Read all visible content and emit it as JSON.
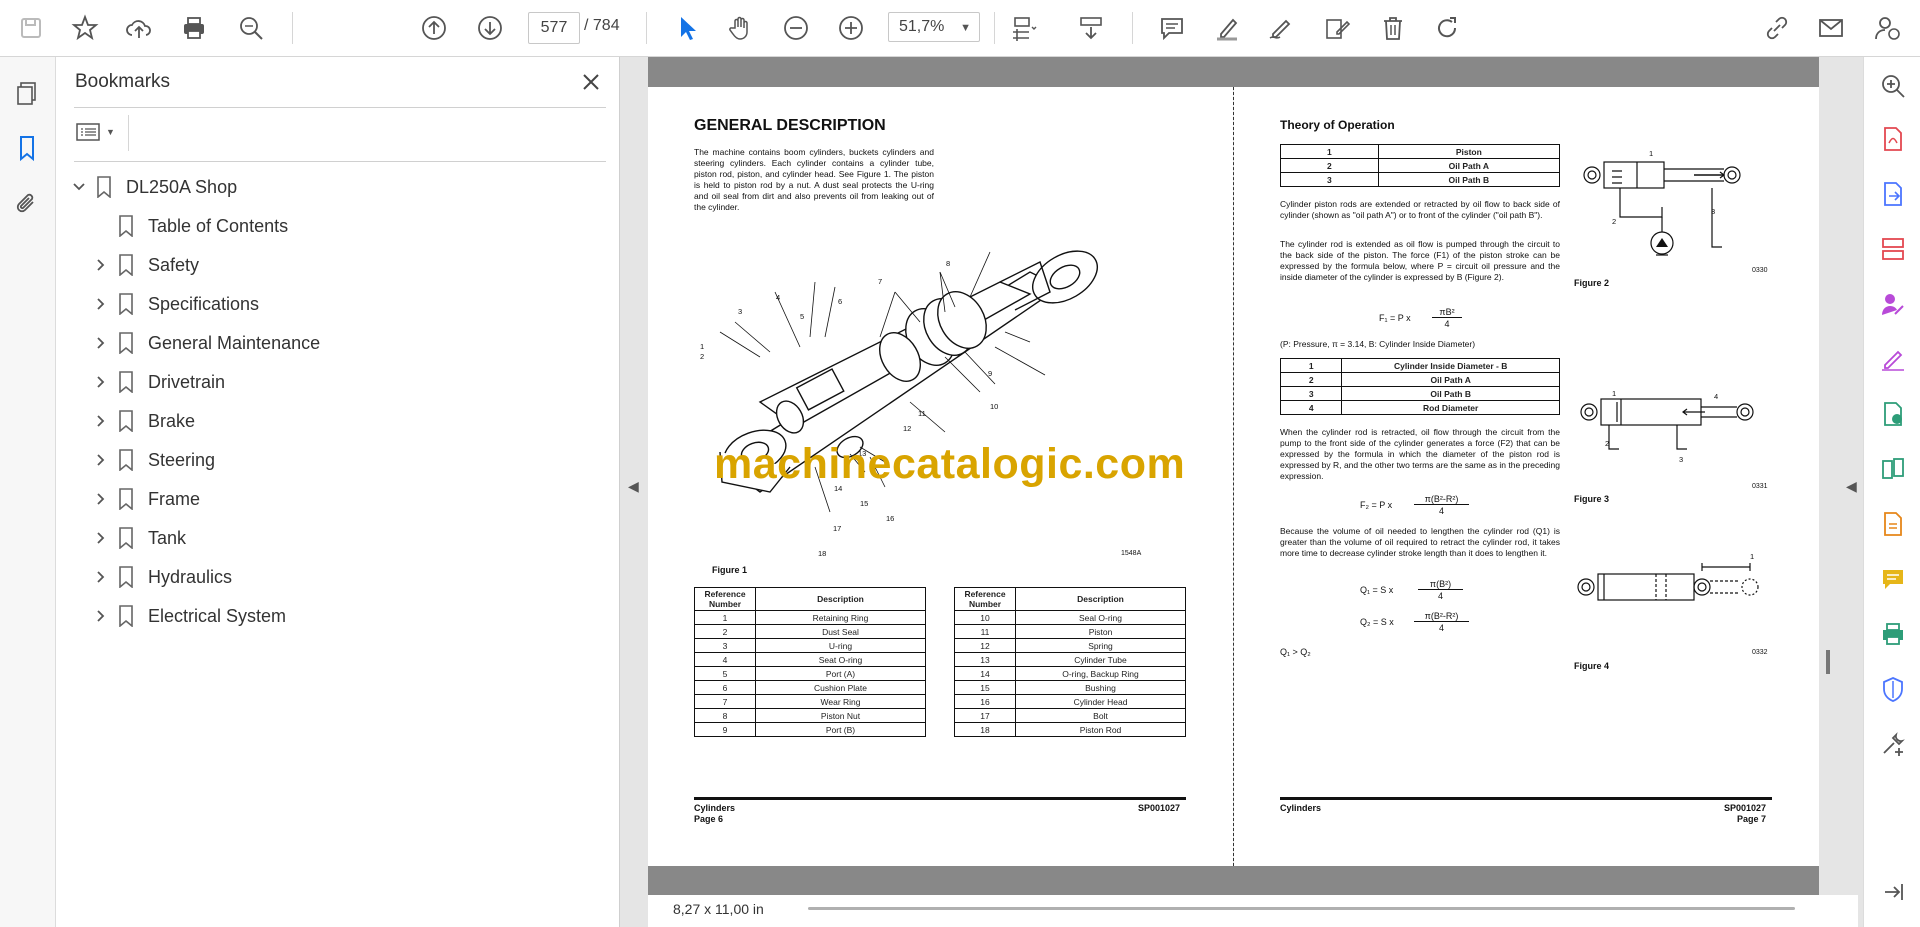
{
  "toolbar": {
    "current_page": "577",
    "total_pages": "/ 784",
    "zoom": "51,7%"
  },
  "bookmarks": {
    "title": "Bookmarks",
    "root": "DL250A Shop",
    "items": [
      {
        "label": "Table of Contents",
        "expandable": false
      },
      {
        "label": "Safety",
        "expandable": true
      },
      {
        "label": "Specifications",
        "expandable": true
      },
      {
        "label": "General Maintenance",
        "expandable": true
      },
      {
        "label": "Drivetrain",
        "expandable": true
      },
      {
        "label": "Brake",
        "expandable": true
      },
      {
        "label": "Steering",
        "expandable": true
      },
      {
        "label": "Frame",
        "expandable": true
      },
      {
        "label": "Tank",
        "expandable": true
      },
      {
        "label": "Hydraulics",
        "expandable": true
      },
      {
        "label": "Electrical System",
        "expandable": true
      }
    ]
  },
  "status": {
    "page_size": "8,27 x 11,00 in"
  },
  "watermark": "machinecatalogic.com",
  "page_left": {
    "heading": "GENERAL DESCRIPTION",
    "intro": "The machine contains boom cylinders, buckets cylinders and steering cylinders. Each cylinder contains a cylinder tube, piston rod, piston, and cylinder head. See Figure 1. The piston is held to piston rod by a nut. A dust seal protects the U-ring and oil seal from dirt and also prevents oil from leaking out of the cylinder.",
    "figure_caption": "Figure 1",
    "figure_code": "1548A",
    "callouts": [
      "1",
      "2",
      "3",
      "4",
      "5",
      "6",
      "7",
      "8",
      "9",
      "10",
      "11",
      "12",
      "13",
      "14",
      "15",
      "16",
      "17",
      "18"
    ],
    "table_headers": [
      "Reference Number",
      "Description"
    ],
    "table1": [
      [
        "1",
        "Retaining Ring"
      ],
      [
        "2",
        "Dust Seal"
      ],
      [
        "3",
        "U-ring"
      ],
      [
        "4",
        "Seat O-ring"
      ],
      [
        "5",
        "Port (A)"
      ],
      [
        "6",
        "Cushion Plate"
      ],
      [
        "7",
        "Wear Ring"
      ],
      [
        "8",
        "Piston Nut"
      ],
      [
        "9",
        "Port (B)"
      ]
    ],
    "table2": [
      [
        "10",
        "Seal O-ring"
      ],
      [
        "11",
        "Piston"
      ],
      [
        "12",
        "Spring"
      ],
      [
        "13",
        "Cylinder Tube"
      ],
      [
        "14",
        "O-ring, Backup Ring"
      ],
      [
        "15",
        "Bushing"
      ],
      [
        "16",
        "Cylinder Head"
      ],
      [
        "17",
        "Bolt"
      ],
      [
        "18",
        "Piston Rod"
      ]
    ],
    "footer_left": "Cylinders",
    "footer_page": "Page 6",
    "footer_right": "SP001027"
  },
  "page_right": {
    "heading": "Theory of Operation",
    "table_a": [
      [
        "1",
        "Piston"
      ],
      [
        "2",
        "Oil Path A"
      ],
      [
        "3",
        "Oil Path B"
      ]
    ],
    "p1": "Cylinder piston rods are extended or retracted by oil flow to back side of cylinder (shown as \"oil path A\") or to front of the cylinder (\"oil path B\").",
    "p2": "The cylinder rod is extended as oil flow is pumped through the circuit to the back side of the piston. The force (F1) of the piston stroke can be expressed by the formula below, where P = circuit oil pressure and the inside diameter of the cylinder is expressed by B (Figure 2).",
    "f1_lhs": "F₁ = P x",
    "f1_num": "πB²",
    "f1_den": "4",
    "legend": "(P: Pressure, π = 3.14, B: Cylinder Inside Diameter)",
    "table_b": [
      [
        "1",
        "Cylinder Inside Diameter - B"
      ],
      [
        "2",
        "Oil Path A"
      ],
      [
        "3",
        "Oil Path B"
      ],
      [
        "4",
        "Rod Diameter"
      ]
    ],
    "p3": "When the cylinder rod is retracted, oil flow through the circuit from the pump to the front side of the cylinder generates a force (F2) that can be expressed by the formula in which the diameter of the piston rod is expressed by R, and the other two terms are the same as in the preceding expression.",
    "f2_lhs": "F₂ = P x",
    "f2_num": "π(B²-R²)",
    "f2_den": "4",
    "p4": "Because the volume of oil needed to lengthen the cylinder rod (Q1) is greater than the volume of oil required to retract the cylinder rod, it takes more time to decrease cylinder stroke length than it does to lengthen it.",
    "q1_lhs": "Q₁ = S x",
    "q1_num": "π(B²)",
    "q1_den": "4",
    "q2_lhs": "Q₂ = S x",
    "q2_num": "π(B²-R²)",
    "q2_den": "4",
    "q_cmp": "Q₁ > Q₂",
    "fig2": "Figure 2",
    "fig2_code": "0330",
    "fig3": "Figure 3",
    "fig3_code": "0331",
    "fig4": "Figure 4",
    "fig4_code": "0332",
    "fig_labels": [
      "1",
      "2",
      "3",
      "4"
    ],
    "footer_left": "Cylinders",
    "footer_right": "SP001027",
    "footer_page": "Page 7"
  }
}
